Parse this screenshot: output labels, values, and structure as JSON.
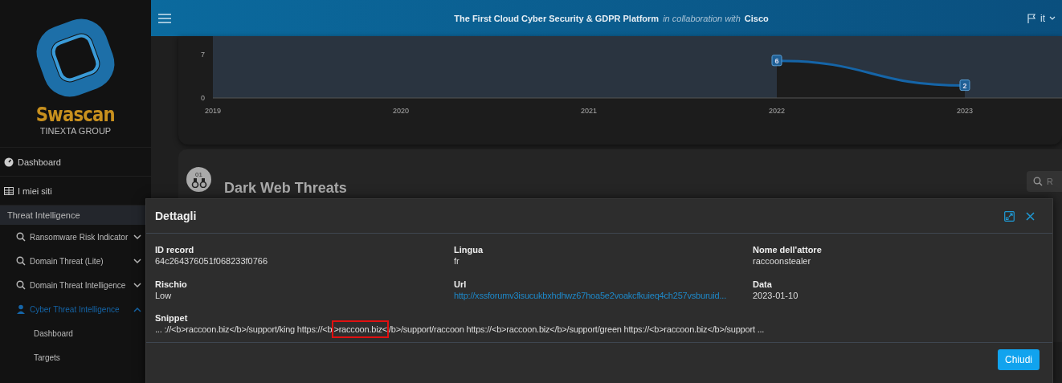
{
  "sidebar": {
    "logo": {
      "name": "Swascan",
      "subtitle": "TINEXTA GROUP"
    },
    "items": [
      {
        "kind": "link",
        "label": "Dashboard",
        "selected": false
      },
      {
        "kind": "link",
        "label": "I miei siti",
        "selected": false
      },
      {
        "kind": "section",
        "label": "Threat Intelligence",
        "selected": false
      },
      {
        "kind": "group",
        "label": "Ransomware Risk Indicator",
        "selected": false,
        "expanded": false
      },
      {
        "kind": "group",
        "label": "Domain Threat (Lite)",
        "selected": false,
        "expanded": false
      },
      {
        "kind": "group",
        "label": "Domain Threat Intelligence",
        "selected": false,
        "expanded": false
      },
      {
        "kind": "group",
        "label": "Cyber Threat Intelligence",
        "selected": true,
        "expanded": true
      },
      {
        "kind": "sub",
        "label": "Dashboard",
        "selected": false
      },
      {
        "kind": "sub",
        "label": "Targets",
        "selected": false
      }
    ]
  },
  "header": {
    "title": "The First Cloud Cyber Security & GDPR Platform",
    "collab": "in collaboration with",
    "partner": "Cisco",
    "language": "it"
  },
  "chart": {
    "chart_data": {
      "type": "area",
      "categories": [
        "2019",
        "2020",
        "2021",
        "2022",
        "2023"
      ],
      "series": [
        {
          "color": "#1565a8",
          "values": [
            null,
            null,
            null,
            6,
            2
          ]
        }
      ],
      "ylim": [
        0,
        10
      ],
      "yticks": [
        0,
        7
      ],
      "data_labels": true
    }
  },
  "section": {
    "badge": "01",
    "title": "Dark Web Threats",
    "search": {
      "placeholder": "R"
    }
  },
  "modal": {
    "title": "Dettagli",
    "fields": [
      {
        "kind": "text",
        "label": "ID record",
        "value": "64c264376051f068233f0766"
      },
      {
        "kind": "text",
        "label": "Lingua",
        "value": "fr"
      },
      {
        "kind": "text",
        "label": "Nome dell'attore",
        "value": "raccoonstealer"
      },
      {
        "kind": "text",
        "label": "Rischio",
        "value": "Low"
      },
      {
        "kind": "link",
        "label": "Url",
        "value": "http://xssforumv3isucukbxhdhwz67hoa5e2voakcfkuieq4ch257vsburuid..."
      },
      {
        "kind": "text",
        "label": "Data",
        "value": "2023-01-10"
      }
    ],
    "snippet": {
      "label": "Snippet",
      "before": "... ://<b>raccoon.biz</b>/support/king https://<b",
      "highlighted": ">raccoon.biz<",
      "after": "/b>/support/raccoon https://<b>raccoon.biz</b>/support/green https://<b>raccoon.biz</b>/support ..."
    },
    "button": "Chiudi"
  }
}
